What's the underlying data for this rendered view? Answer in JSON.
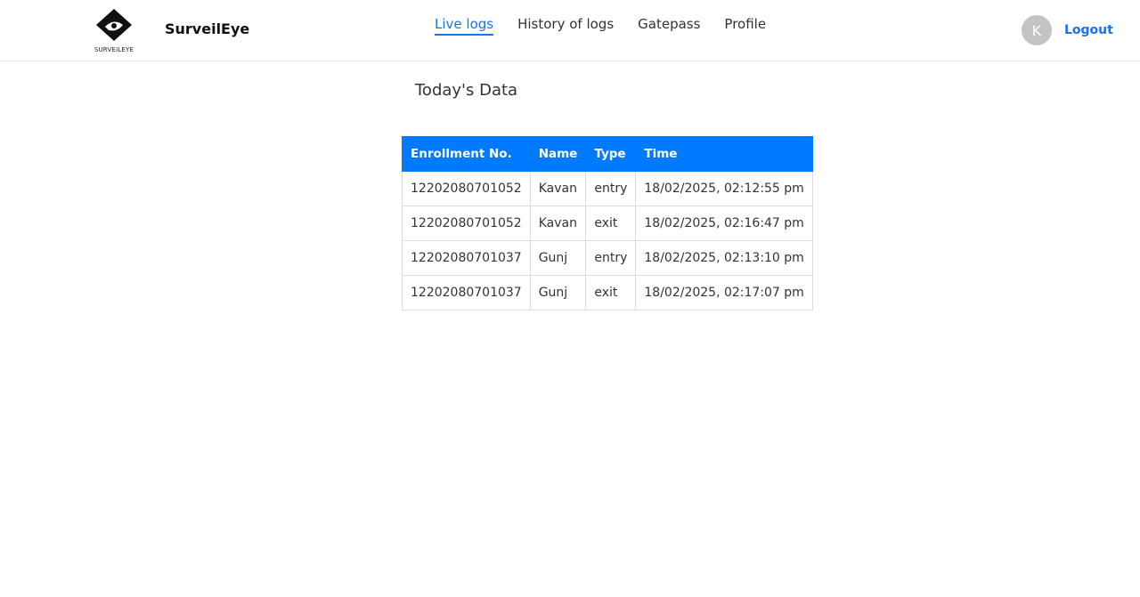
{
  "brand": {
    "logo_caption": "SURVEILEYE",
    "name": "SurveilEye"
  },
  "nav": {
    "items": [
      {
        "label": "Live logs",
        "active": true
      },
      {
        "label": "History of logs",
        "active": false
      },
      {
        "label": "Gatepass",
        "active": false
      },
      {
        "label": "Profile",
        "active": false
      }
    ]
  },
  "user": {
    "avatar_initial": "K",
    "logout_label": "Logout"
  },
  "main": {
    "title": "Today's Data",
    "table": {
      "headers": [
        "Enrollment No.",
        "Name",
        "Type",
        "Time"
      ],
      "rows": [
        [
          "12202080701052",
          "Kavan",
          "entry",
          "18/02/2025, 02:12:55 pm"
        ],
        [
          "12202080701052",
          "Kavan",
          "exit",
          "18/02/2025, 02:16:47 pm"
        ],
        [
          "12202080701037",
          "Gunj",
          "entry",
          "18/02/2025, 02:13:10 pm"
        ],
        [
          "12202080701037",
          "Gunj",
          "exit",
          "18/02/2025, 02:17:07 pm"
        ]
      ]
    }
  },
  "colors": {
    "accent": "#1a73e8",
    "table_header": "#007bff",
    "avatar": "#c4c4c4"
  }
}
